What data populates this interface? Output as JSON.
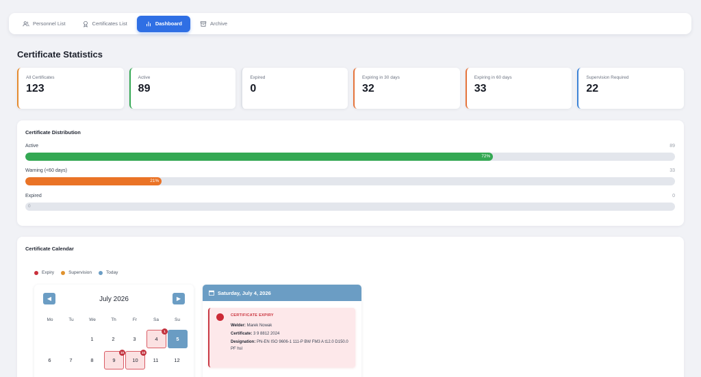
{
  "nav": {
    "tabs": [
      {
        "label": "Personnel List",
        "icon": "users-icon"
      },
      {
        "label": "Certificates List",
        "icon": "award-icon"
      },
      {
        "label": "Dashboard",
        "icon": "bar-chart-icon",
        "active": true
      },
      {
        "label": "Archive",
        "icon": "archive-icon"
      }
    ]
  },
  "page": {
    "title": "Certificate Statistics"
  },
  "stats": [
    {
      "label": "All Certificates",
      "value": "123",
      "color": "#e58a2e"
    },
    {
      "label": "Active",
      "value": "89",
      "color": "#34a853"
    },
    {
      "label": "Expired",
      "value": "0",
      "color": "#dfe2e8"
    },
    {
      "label": "Expiring in 30 days",
      "value": "32",
      "color": "#e5733a"
    },
    {
      "label": "Expiring in 60 days",
      "value": "33",
      "color": "#e5733a"
    },
    {
      "label": "Supervision Required",
      "value": "22",
      "color": "#3b82d6"
    }
  ],
  "distribution": {
    "title": "Certificate Distribution",
    "rows": [
      {
        "label": "Active",
        "count": "89",
        "percent": 72,
        "percent_label": "72%",
        "color": "#34a853"
      },
      {
        "label": "Warning (<60 days)",
        "count": "33",
        "percent": 21,
        "percent_label": "21%",
        "color": "#ea7326"
      },
      {
        "label": "Expired",
        "count": "0",
        "percent": 0,
        "percent_label": "0",
        "color": "#dfe2e8"
      }
    ]
  },
  "calendar": {
    "title": "Certificate Calendar",
    "legend": [
      {
        "label": "Expiry",
        "color": "#c9303b"
      },
      {
        "label": "Supervision",
        "color": "#e0922e"
      },
      {
        "label": "Today",
        "color": "#6b9dc4"
      }
    ],
    "month_label": "July 2026",
    "prev_icon": "chevron-left-icon",
    "next_icon": "chevron-right-icon",
    "weekdays": [
      "Mo",
      "Tu",
      "We",
      "Th",
      "Fr",
      "Sa",
      "Su"
    ],
    "weeks": [
      [
        null,
        null,
        {
          "d": "1"
        },
        {
          "d": "2"
        },
        {
          "d": "3"
        },
        {
          "d": "4",
          "type": "expiry",
          "badge": "1"
        },
        {
          "d": "5",
          "type": "today"
        }
      ],
      [
        {
          "d": "6"
        },
        {
          "d": "7"
        },
        {
          "d": "8"
        },
        {
          "d": "9",
          "type": "expiry",
          "badge": "10"
        },
        {
          "d": "10",
          "type": "expiry",
          "badge": "10"
        },
        {
          "d": "11"
        },
        {
          "d": "12"
        }
      ]
    ]
  },
  "detail": {
    "date_label": "Saturday, July 4, 2026",
    "icon": "calendar-icon",
    "event": {
      "type_label": "CERTIFICATE EXPIRY",
      "welder_key": "Welder:",
      "welder": "Marek Nowak",
      "certificate_key": "Certificate:",
      "certificate": "3 9 8812 2024",
      "designation_key": "Designation:",
      "designation": "PN-EN ISO 9606-1 111-P BW FM3 A t12.0 D150.0 PF hsl"
    }
  }
}
